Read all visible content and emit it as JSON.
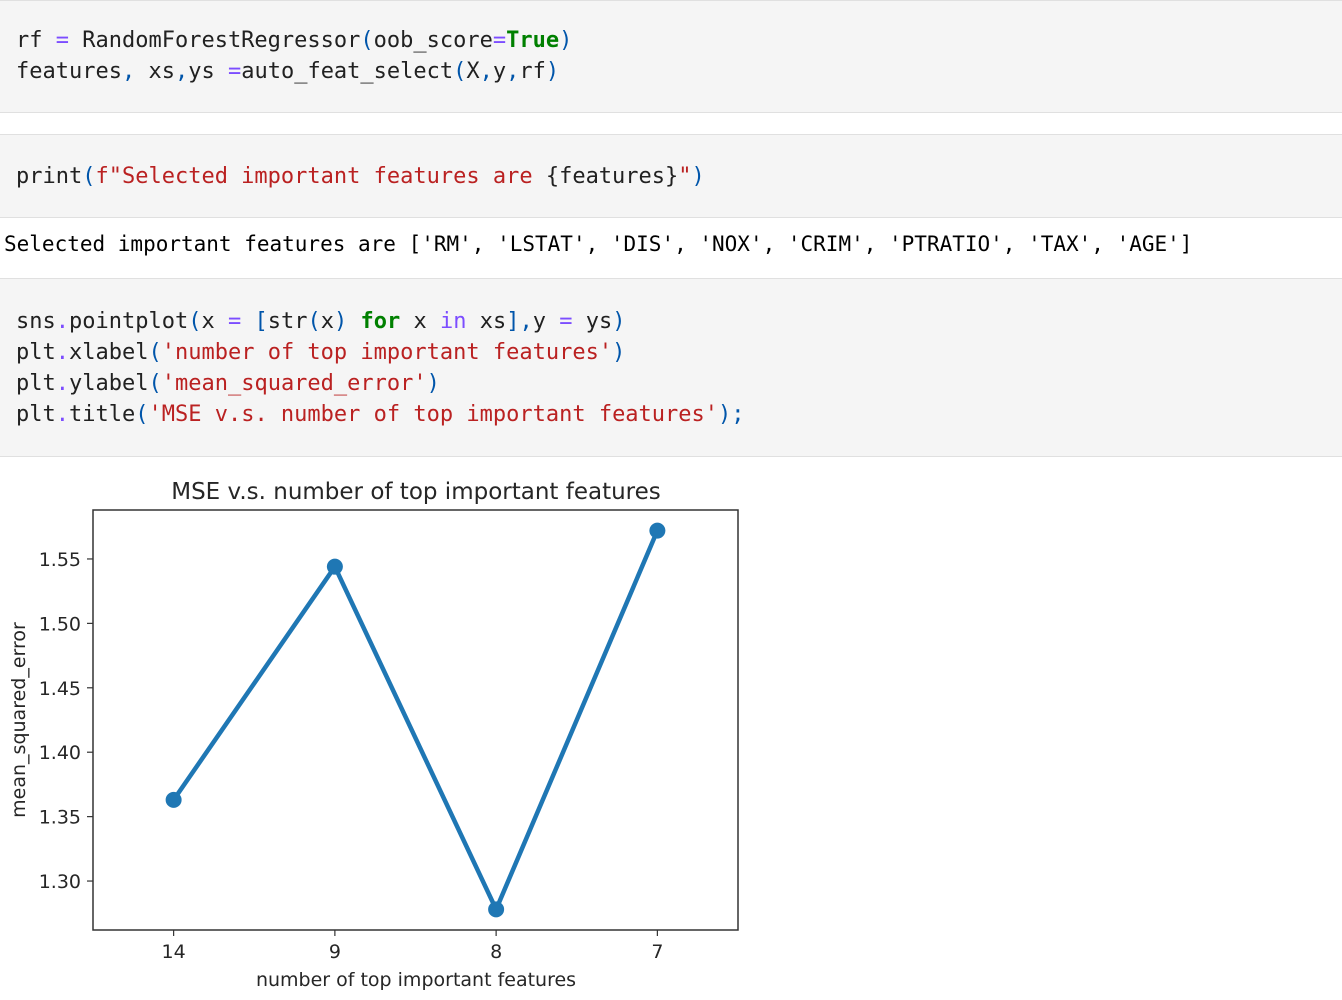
{
  "cells": [
    {
      "lines": [
        [
          [
            "rf ",
            "plain"
          ],
          [
            "=",
            "op"
          ],
          [
            " RandomForestRegressor",
            "plain"
          ],
          [
            "(",
            "br"
          ],
          [
            "oob_score",
            "plain"
          ],
          [
            "=",
            "op"
          ],
          [
            "True",
            "kw"
          ],
          [
            ")",
            "br"
          ]
        ],
        [
          [
            "features",
            "plain"
          ],
          [
            ",",
            "br"
          ],
          [
            " xs",
            "plain"
          ],
          [
            ",",
            "br"
          ],
          [
            "ys ",
            "plain"
          ],
          [
            "=",
            "op"
          ],
          [
            "auto_feat_select",
            "plain"
          ],
          [
            "(",
            "br"
          ],
          [
            "X",
            "plain"
          ],
          [
            ",",
            "br"
          ],
          [
            "y",
            "plain"
          ],
          [
            ",",
            "br"
          ],
          [
            "rf",
            "plain"
          ],
          [
            ")",
            "br"
          ]
        ]
      ]
    },
    {
      "lines": [
        [
          [
            "print",
            "plain"
          ],
          [
            "(",
            "br"
          ],
          [
            "f\"Selected important features are ",
            "str"
          ],
          [
            "{features}",
            "tpl"
          ],
          [
            "\"",
            "str"
          ],
          [
            ")",
            "br"
          ]
        ]
      ]
    },
    {
      "lines": [
        [
          [
            "sns",
            "plain"
          ],
          [
            ".",
            "op"
          ],
          [
            "pointplot",
            "plain"
          ],
          [
            "(",
            "br"
          ],
          [
            "x ",
            "plain"
          ],
          [
            "=",
            "op"
          ],
          [
            " ",
            "plain"
          ],
          [
            "[",
            "br"
          ],
          [
            "str",
            "plain"
          ],
          [
            "(",
            "br"
          ],
          [
            "x",
            "plain"
          ],
          [
            ")",
            "br"
          ],
          [
            " ",
            "plain"
          ],
          [
            "for",
            "kw"
          ],
          [
            " x ",
            "plain"
          ],
          [
            "in",
            "op"
          ],
          [
            " xs",
            "plain"
          ],
          [
            "]",
            "br"
          ],
          [
            ",",
            "br"
          ],
          [
            "y ",
            "plain"
          ],
          [
            "=",
            "op"
          ],
          [
            " ys",
            "plain"
          ],
          [
            ")",
            "br"
          ]
        ],
        [
          [
            "plt",
            "plain"
          ],
          [
            ".",
            "op"
          ],
          [
            "xlabel",
            "plain"
          ],
          [
            "(",
            "br"
          ],
          [
            "'number of top important features'",
            "str"
          ],
          [
            ")",
            "br"
          ]
        ],
        [
          [
            "plt",
            "plain"
          ],
          [
            ".",
            "op"
          ],
          [
            "ylabel",
            "plain"
          ],
          [
            "(",
            "br"
          ],
          [
            "'mean_squared_error'",
            "str"
          ],
          [
            ")",
            "br"
          ]
        ],
        [
          [
            "plt",
            "plain"
          ],
          [
            ".",
            "op"
          ],
          [
            "title",
            "plain"
          ],
          [
            "(",
            "br"
          ],
          [
            "'MSE v.s. number of top important features'",
            "str"
          ],
          [
            ")",
            "br"
          ],
          [
            ";",
            "br"
          ]
        ]
      ]
    }
  ],
  "output": {
    "text": "Selected important features are ['RM', 'LSTAT', 'DIS', 'NOX', 'CRIM', 'PTRATIO', 'TAX', 'AGE']"
  },
  "colors": {
    "operator": "#7c4dff",
    "keyword": "#008000",
    "string": "#ba2121",
    "bracket": "#0055aa",
    "plain": "#212121",
    "series": "#1f77b4"
  },
  "chart_data": {
    "type": "line",
    "title": "MSE v.s. number of top important features",
    "xlabel": "number of top important features",
    "ylabel": "mean_squared_error",
    "categories": [
      "14",
      "9",
      "8",
      "7"
    ],
    "values": [
      1.363,
      1.544,
      1.278,
      1.572
    ],
    "ylim": [
      1.262,
      1.588
    ],
    "yticks": [
      1.3,
      1.35,
      1.4,
      1.45,
      1.5,
      1.55
    ],
    "ytick_labels": [
      "1.30",
      "1.35",
      "1.40",
      "1.45",
      "1.50",
      "1.55"
    ],
    "grid": false,
    "markers": true,
    "color": "#1f77b4"
  }
}
